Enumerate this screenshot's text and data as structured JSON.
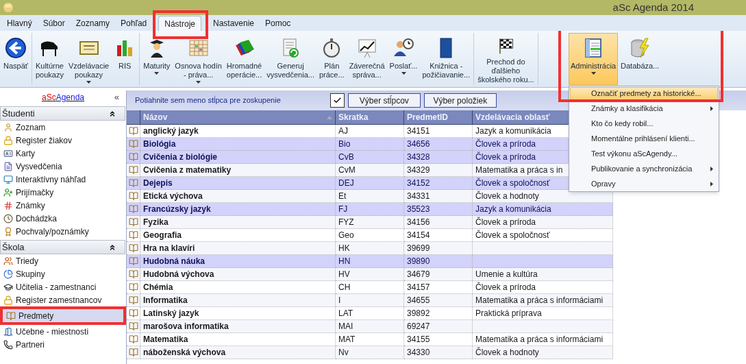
{
  "window": {
    "title": "aSc Agenda 2014"
  },
  "tabs": [
    {
      "label": "Hlavný",
      "selected": false
    },
    {
      "label": "Súbor",
      "selected": false
    },
    {
      "label": "Zoznamy",
      "selected": false
    },
    {
      "label": "Pohľad",
      "selected": false
    },
    {
      "label": "Nástroje",
      "selected": true
    },
    {
      "label": "Nastavenie",
      "selected": false
    },
    {
      "label": "Pomoc",
      "selected": false
    }
  ],
  "ribbon": {
    "groups": [
      {
        "buttons": [
          {
            "lines": [
              "Naspäť"
            ],
            "dropdown": false,
            "selected": false
          }
        ]
      },
      {
        "buttons": [
          {
            "lines": [
              "Kultúrne",
              "poukazy"
            ],
            "dropdown": false,
            "selected": false
          },
          {
            "lines": [
              "Vzdelávacie",
              "poukazy"
            ],
            "dropdown": true,
            "selected": false
          },
          {
            "lines": [
              "RIS"
            ],
            "dropdown": false,
            "selected": false
          }
        ]
      },
      {
        "buttons": [
          {
            "lines": [
              "Maturity"
            ],
            "dropdown": true,
            "selected": false
          },
          {
            "lines": [
              "Osnova hodín",
              "- práva..."
            ],
            "dropdown": true,
            "selected": false
          },
          {
            "lines": [
              "Hromadné",
              "operácie..."
            ],
            "dropdown": false,
            "selected": false
          },
          {
            "lines": [
              "Generuj",
              "vysvedčenia..."
            ],
            "dropdown": false,
            "selected": false
          },
          {
            "lines": [
              "Plán",
              "práce..."
            ],
            "dropdown": false,
            "selected": false
          },
          {
            "lines": [
              "Záverečná",
              "správa..."
            ],
            "dropdown": false,
            "selected": false
          },
          {
            "lines": [
              "Poslať..."
            ],
            "dropdown": true,
            "selected": false
          },
          {
            "lines": [
              "Knižnica -",
              "požičiavanie..."
            ],
            "dropdown": false,
            "selected": false
          }
        ]
      },
      {
        "buttons": [
          {
            "lines": [
              "Prechod do",
              "ďalšieho",
              "školského roku..."
            ],
            "dropdown": false,
            "selected": false
          }
        ]
      },
      {
        "buttons": [
          {
            "lines": [
              "Administrácia"
            ],
            "dropdown": true,
            "selected": true
          },
          {
            "lines": [
              "Databáza..."
            ],
            "dropdown": false,
            "selected": false
          }
        ]
      }
    ]
  },
  "sidebar": {
    "logo_link": {
      "prefix": "aSc",
      "rest": "Agenda"
    },
    "collapse": "«",
    "sections": [
      {
        "title": "Študenti",
        "items": [
          {
            "label": "Zoznam",
            "selected": false
          },
          {
            "label": "Register žiakov",
            "selected": false
          },
          {
            "label": "Karty",
            "selected": false
          },
          {
            "label": "Vysvedčenia",
            "selected": false
          },
          {
            "label": "Interaktívny náhľad",
            "selected": false
          },
          {
            "label": "Prijímačky",
            "selected": false
          },
          {
            "label": "Známky",
            "selected": false
          },
          {
            "label": "Dochádzka",
            "selected": false
          },
          {
            "label": "Pochvaly/poznámky",
            "selected": false
          }
        ]
      },
      {
        "title": "Škola",
        "items": [
          {
            "label": "Triedy",
            "selected": false
          },
          {
            "label": "Skupiny",
            "selected": false
          },
          {
            "label": "Učitelia - zamestnanci",
            "selected": false
          },
          {
            "label": "Register zamestnancov",
            "selected": false
          },
          {
            "label": "Predmety",
            "selected": true
          },
          {
            "label": "Učebne - miestnosti",
            "selected": false
          },
          {
            "label": "Partneri",
            "selected": false
          }
        ]
      }
    ]
  },
  "grid": {
    "group_hint": "Potiahnite sem meno stĺpca pre zoskupenie",
    "all_checked": true,
    "buttons": [
      "Výber stĺpcov",
      "Výber položiek"
    ],
    "columns": [
      "Názov",
      "Skratka",
      "PredmetID",
      "Vzdelávacia oblasť"
    ],
    "rows": [
      {
        "cells": [
          "anglický jazyk",
          "AJ",
          "34151",
          "Jazyk a komunikácia"
        ],
        "selected": false
      },
      {
        "cells": [
          "Biológia",
          "Bio",
          "34656",
          "Človek a príroda"
        ],
        "selected": true
      },
      {
        "cells": [
          "Cvičenia z biológie",
          "CvB",
          "34328",
          "Človek a príroda"
        ],
        "selected": true
      },
      {
        "cells": [
          "Cvičenia z matematiky",
          "CvM",
          "34329",
          "Matematika a práca s in"
        ],
        "selected": false
      },
      {
        "cells": [
          "Dejepis",
          "DEJ",
          "34152",
          "Človek a spoločnosť"
        ],
        "selected": true
      },
      {
        "cells": [
          "Etická výchova",
          "Et",
          "34331",
          "Človek a hodnoty"
        ],
        "selected": false
      },
      {
        "cells": [
          "Francúzsky jazyk",
          "FJ",
          "35523",
          "Jazyk a komunikácia"
        ],
        "selected": true
      },
      {
        "cells": [
          "Fyzika",
          "FYZ",
          "34156",
          "Človek a príroda"
        ],
        "selected": false
      },
      {
        "cells": [
          "Geografia",
          "Geo",
          "34154",
          "Človek a spoločnosť"
        ],
        "selected": false
      },
      {
        "cells": [
          "Hra na klavíri",
          "HK",
          "39699",
          ""
        ],
        "selected": false
      },
      {
        "cells": [
          "Hudobná náuka",
          "HN",
          "39890",
          ""
        ],
        "selected": true
      },
      {
        "cells": [
          "Hudobná výchova",
          "HV",
          "34679",
          "Umenie a kultúra"
        ],
        "selected": false
      },
      {
        "cells": [
          "Chémia",
          "CH",
          "34157",
          "Človek a príroda"
        ],
        "selected": false
      },
      {
        "cells": [
          "Informatika",
          "I",
          "34655",
          "Matematika a práca s informáciami"
        ],
        "selected": false
      },
      {
        "cells": [
          "Latinský jazyk",
          "LAT",
          "39892",
          "Praktická príprava"
        ],
        "selected": false
      },
      {
        "cells": [
          "marošova informatika",
          "MAI",
          "69247",
          ""
        ],
        "selected": false
      },
      {
        "cells": [
          "Matematika",
          "MAT",
          "34155",
          "Matematika a práca s informáciami"
        ],
        "selected": false
      },
      {
        "cells": [
          "náboženská výchova",
          "Nv",
          "34330",
          "Človek a hodnoty"
        ],
        "selected": false
      }
    ]
  },
  "menu": {
    "items": [
      {
        "label": "Označiť predmety za historické...",
        "submenu": false,
        "selected": true
      },
      {
        "label": "Známky a klasifikácia",
        "submenu": true,
        "selected": false
      },
      {
        "label": "Kto čo kedy robil...",
        "submenu": false,
        "selected": false
      },
      {
        "label": "Momentálne prihlásení klienti...",
        "submenu": false,
        "selected": false
      },
      {
        "label": "Test výkonu aScAgendy...",
        "submenu": false,
        "selected": false
      },
      {
        "label": "Publikovanie a synchronizácia",
        "submenu": true,
        "selected": false
      },
      {
        "label": "Opravy",
        "submenu": true,
        "selected": false
      }
    ]
  }
}
